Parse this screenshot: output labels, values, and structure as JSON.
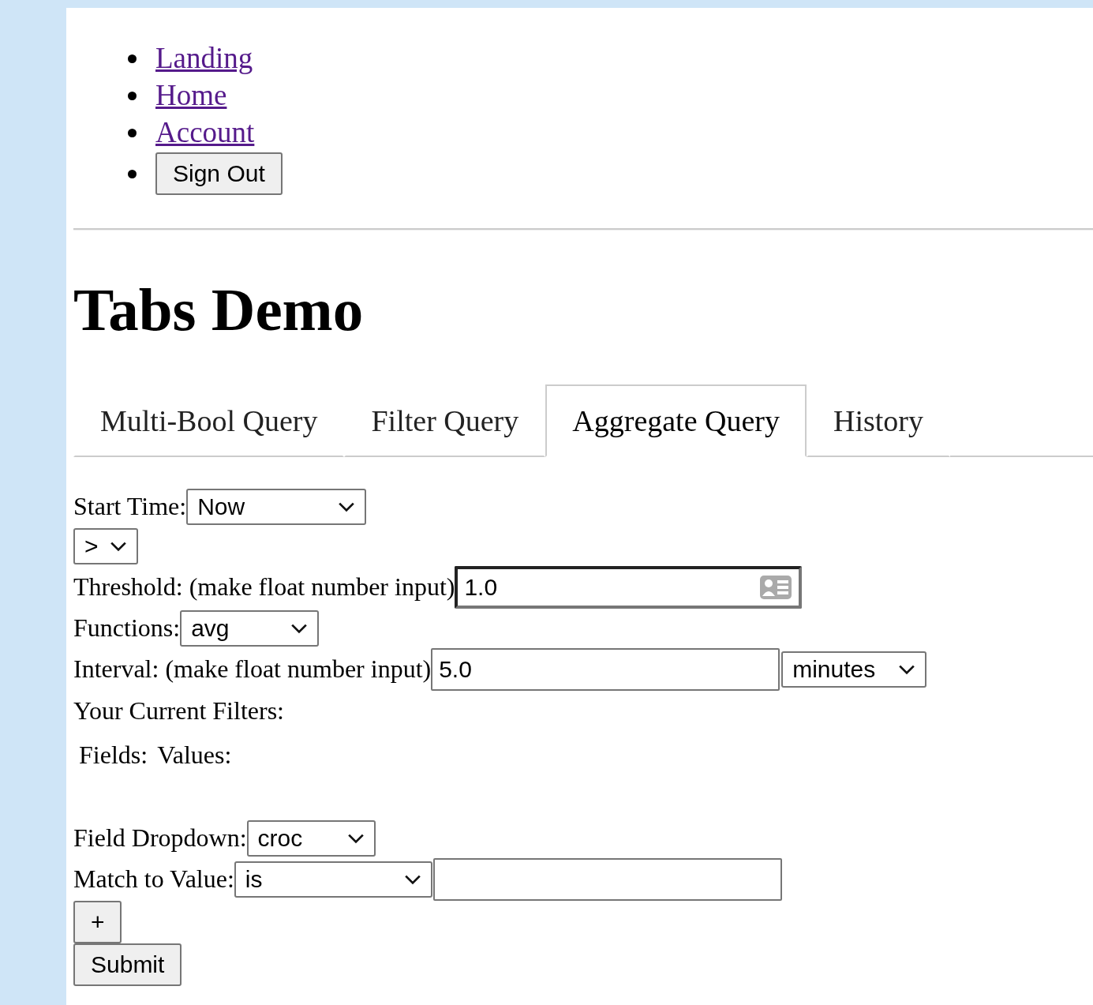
{
  "nav": [
    {
      "kind": "link",
      "label": "Landing"
    },
    {
      "kind": "link",
      "label": "Home"
    },
    {
      "kind": "link",
      "label": "Account"
    },
    {
      "kind": "button",
      "label": "Sign Out"
    }
  ],
  "heading": "Tabs Demo",
  "tabs": [
    {
      "label": "Multi-Bool Query",
      "selected": false
    },
    {
      "label": "Filter Query",
      "selected": false
    },
    {
      "label": "Aggregate Query",
      "selected": true
    },
    {
      "label": "History",
      "selected": false
    }
  ],
  "form": {
    "start_time": {
      "label": "Start Time:",
      "value": "Now"
    },
    "operator": {
      "value": ">"
    },
    "threshold": {
      "label": "Threshold: (make float number input)",
      "value": "1.0",
      "focused": true
    },
    "functions": {
      "label": "Functions:",
      "value": "avg"
    },
    "interval": {
      "label": "Interval: (make float number input)",
      "value": "5.0",
      "unit": "minutes"
    },
    "filters_heading": "Your Current Filters:",
    "filter_columns": [
      "Fields:",
      "Values:"
    ],
    "field_dropdown": {
      "label": "Field Dropdown:",
      "value": "croc"
    },
    "match": {
      "label": "Match to Value:",
      "operator": "is"
    },
    "add_button": "+",
    "submit_button": "Submit"
  }
}
